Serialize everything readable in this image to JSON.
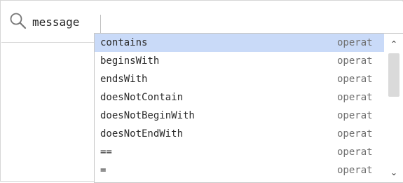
{
  "search": {
    "icon": "search-icon",
    "query": "message"
  },
  "autocomplete": {
    "items": [
      {
        "label": "contains",
        "kind": "operat"
      },
      {
        "label": "beginsWith",
        "kind": "operat"
      },
      {
        "label": "endsWith",
        "kind": "operat"
      },
      {
        "label": "doesNotContain",
        "kind": "operat"
      },
      {
        "label": "doesNotBeginWith",
        "kind": "operat"
      },
      {
        "label": "doesNotEndWith",
        "kind": "operat"
      },
      {
        "label": "==",
        "kind": "operat"
      },
      {
        "label": "=",
        "kind": "operat"
      }
    ],
    "selected_index": 0,
    "scrollbar": {
      "up_icon": "chevron-up-icon",
      "down_icon": "chevron-down-icon",
      "up_glyph": "⌃",
      "down_glyph": "⌄"
    }
  },
  "colors": {
    "selected_row": "#c9daf8",
    "text": "#2b2b2b",
    "kind_text": "#6f6f6f",
    "thumb": "#dadada"
  }
}
